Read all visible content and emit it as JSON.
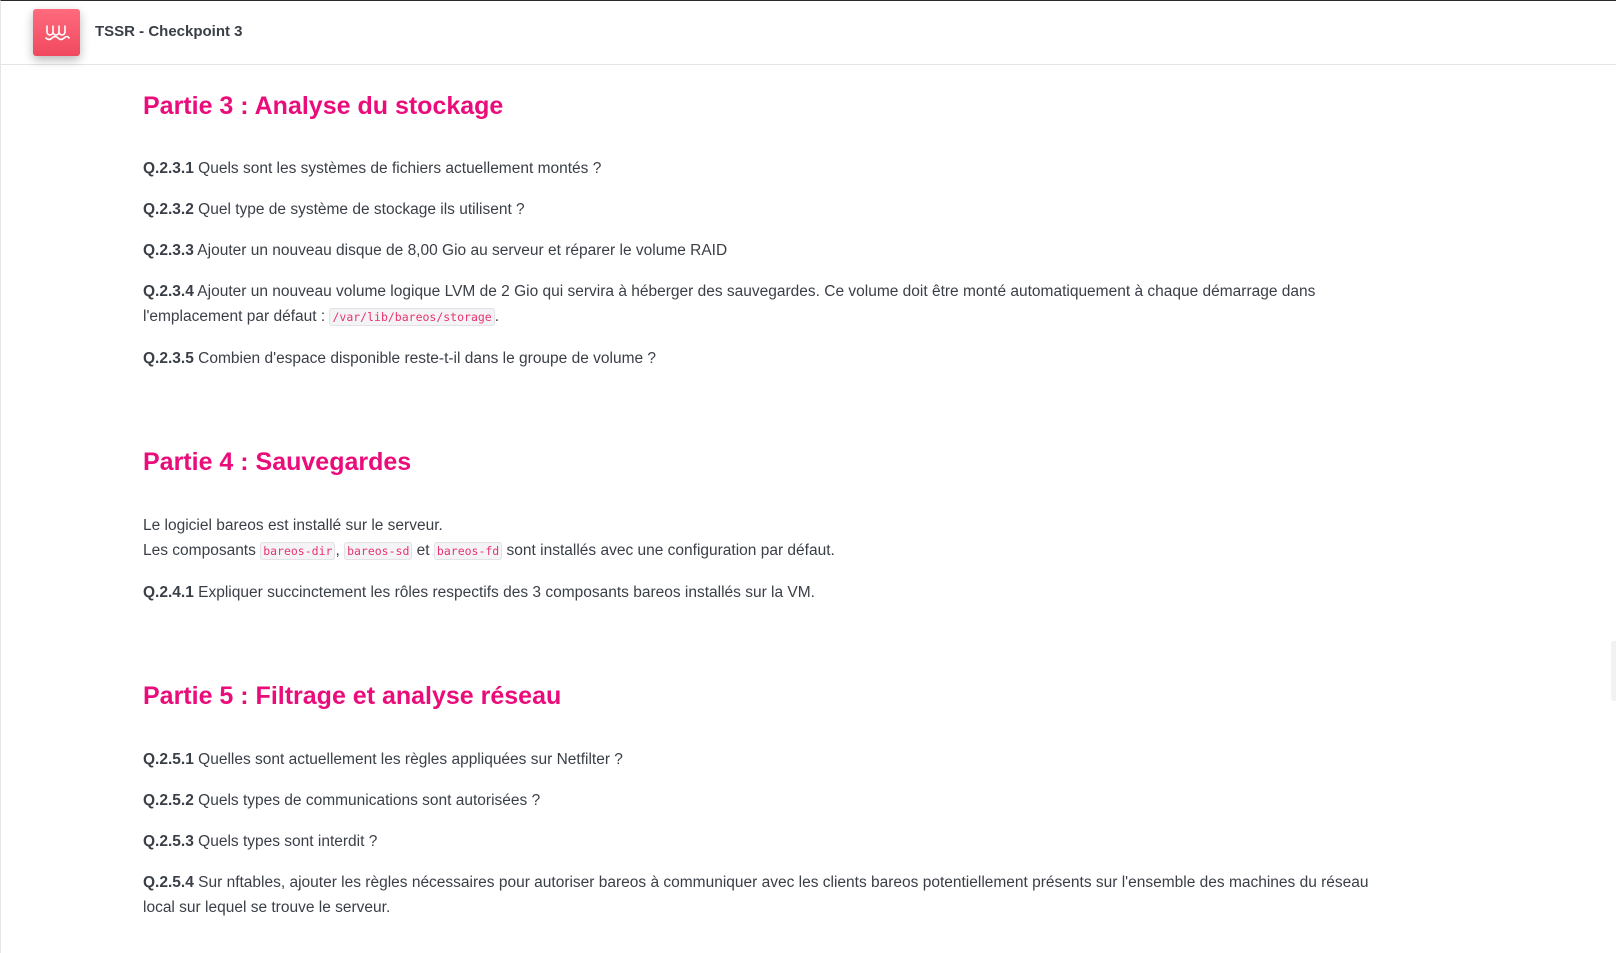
{
  "app": {
    "title": "TSSR - Checkpoint 3",
    "logo_icon": "wave-logo-icon",
    "accent": "#ea0c7a",
    "logo_color": "#f0495f"
  },
  "part3": {
    "heading": "Partie 3 : Analyse du stockage",
    "questions": [
      {
        "id": "Q.2.3.1",
        "text": " Quels sont les systèmes de fichiers actuellement montés ?"
      },
      {
        "id": "Q.2.3.2",
        "text": " Quel type de système de stockage ils utilisent ?"
      },
      {
        "id": "Q.2.3.3",
        "text": " Ajouter un nouveau disque de 8,00 Gio au serveur et réparer le volume RAID"
      },
      {
        "id": "Q.2.3.4",
        "text": " Ajouter un nouveau volume logique LVM de 2 Gio qui servira à héberger des sauvegardes. Ce volume doit être monté automatiquement à chaque démarrage dans l'emplacement par défaut : ",
        "code": "/var/lib/bareos/storage",
        "after": "."
      },
      {
        "id": "Q.2.3.5",
        "text": " Combien d'espace disponible reste-t-il dans le groupe de volume ?"
      }
    ]
  },
  "part4": {
    "heading": "Partie 4 : Sauvegardes",
    "intro_line1": "Le logiciel bareos est installé sur le serveur.",
    "intro_line2_prefix": "Les composants ",
    "code1": "bareos-dir",
    "sep1": ", ",
    "code2": "bareos-sd",
    "sep2": " et ",
    "code3": "bareos-fd",
    "intro_line2_suffix": " sont installés avec une configuration par défaut.",
    "questions": [
      {
        "id": "Q.2.4.1",
        "text": " Expliquer succinctement les rôles respectifs des 3 composants bareos installés sur la VM."
      }
    ]
  },
  "part5": {
    "heading": "Partie 5 : Filtrage et analyse réseau",
    "questions": [
      {
        "id": "Q.2.5.1",
        "text": " Quelles sont actuellement les règles appliquées sur Netfilter ?"
      },
      {
        "id": "Q.2.5.2",
        "text": " Quels types de communications sont autorisées ?"
      },
      {
        "id": "Q.2.5.3",
        "text": " Quels types sont interdit ?"
      },
      {
        "id": "Q.2.5.4",
        "text": " Sur nftables, ajouter les règles nécessaires pour autoriser bareos à communiquer avec les clients bareos potentiellement présents sur l'ensemble des machines du réseau local sur lequel se trouve le serveur."
      }
    ]
  }
}
